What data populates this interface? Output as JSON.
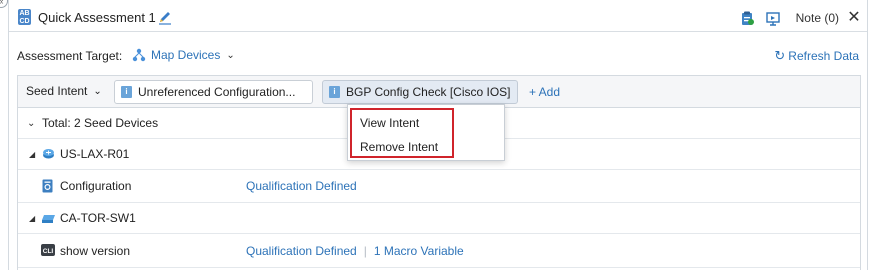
{
  "window": {
    "title": "Quick Assessment 1",
    "note_label": "Note (0)"
  },
  "target": {
    "label": "Assessment Target:",
    "map_devices": "Map Devices",
    "refresh": "Refresh Data"
  },
  "intent_bar": {
    "seed_intent": "Seed Intent",
    "chips": [
      {
        "label": "Unreferenced Configuration..."
      },
      {
        "label": "BGP Config Check [Cisco IOS]"
      }
    ],
    "add": "+ Add"
  },
  "tree": {
    "total": "Total: 2 Seed Devices",
    "devices": [
      {
        "name": "US-LAX-R01",
        "items": [
          {
            "name": "Configuration",
            "values": [
              "Qualification Defined"
            ]
          }
        ]
      },
      {
        "name": "CA-TOR-SW1",
        "items": [
          {
            "name": "show version",
            "values": [
              "Qualification Defined",
              "1 Macro Variable"
            ]
          }
        ]
      }
    ]
  },
  "context_menu": {
    "items": [
      "View Intent",
      "Remove Intent"
    ]
  },
  "colors": {
    "accent": "#2d73b8",
    "highlight_border": "#d0242b",
    "active_chip": "#e3eaf3"
  },
  "icons": {
    "app": "assessment-app-icon",
    "edit": "pencil-icon",
    "clipboard": "clipboard-icon",
    "present": "present-icon",
    "close": "close-icon",
    "map": "map-devices-icon",
    "refresh": "refresh-icon",
    "intent": "intent-badge-icon",
    "router": "router-icon",
    "switch": "switch-icon",
    "config": "configuration-icon",
    "cli": "cli-icon"
  }
}
